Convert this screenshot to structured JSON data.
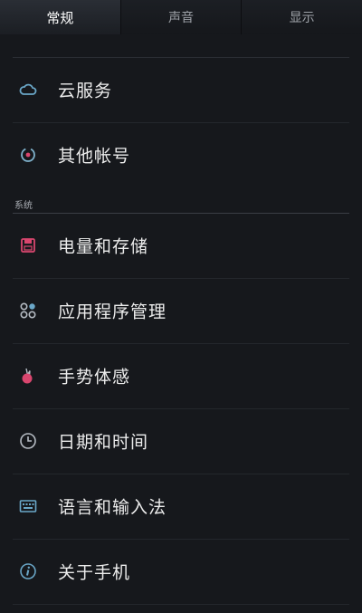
{
  "tabs": [
    {
      "label": "常规",
      "active": true
    },
    {
      "label": "声音",
      "active": false
    },
    {
      "label": "显示",
      "active": false
    }
  ],
  "accounts": {
    "items": [
      {
        "label": "云服务",
        "icon": "cloud-icon"
      },
      {
        "label": "其他帐号",
        "icon": "sync-icon"
      }
    ]
  },
  "system": {
    "header": "系统",
    "items": [
      {
        "label": "电量和存储",
        "icon": "storage-icon"
      },
      {
        "label": "应用程序管理",
        "icon": "apps-icon"
      },
      {
        "label": "手势体感",
        "icon": "gesture-icon"
      },
      {
        "label": "日期和时间",
        "icon": "clock-icon"
      },
      {
        "label": "语言和输入法",
        "icon": "keyboard-icon"
      },
      {
        "label": "关于手机",
        "icon": "info-icon"
      }
    ]
  },
  "colors": {
    "background": "#16181c",
    "accent_pink": "#d9466e",
    "icon_blue": "#6aa7c8",
    "icon_gray": "#b6bcc4"
  }
}
